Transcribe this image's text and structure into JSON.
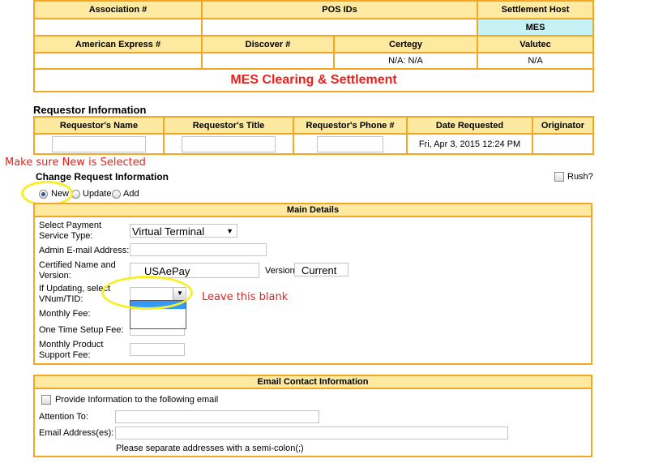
{
  "top_table": {
    "row1": [
      "Association #",
      "POS IDs",
      "Settlement Host"
    ],
    "row2": [
      "",
      "",
      "MES"
    ],
    "row3": [
      "American Express #",
      "Discover #",
      "Certegy",
      "Valutec"
    ],
    "row4": [
      "",
      "",
      "N/A: N/A",
      "N/A"
    ],
    "banner": "MES Clearing & Settlement"
  },
  "requestor": {
    "title": "Requestor Information",
    "headers": [
      "Requestor's Name",
      "Requestor's Title",
      "Requestor's Phone #",
      "Date Requested",
      "Originator"
    ],
    "date_requested": "Fri, Apr 3, 2015 12:24 PM"
  },
  "annotations": {
    "new_selected": "Make sure New is Selected",
    "leave_blank": "Leave this blank"
  },
  "change_request": {
    "title": "Change Request Information",
    "rush_label": "Rush?",
    "radios": [
      {
        "label": "New",
        "selected": true
      },
      {
        "label": "Update",
        "selected": false
      },
      {
        "label": "Add",
        "selected": false
      }
    ]
  },
  "main_details": {
    "header": "Main Details",
    "payment_service_label": "Select Payment Service Type:",
    "payment_service_value": "Virtual Terminal",
    "admin_email_label": "Admin E-mail Address:",
    "certified_label": "Certified Name and Version:",
    "certified_value": "USAePay",
    "version_label": "Version:",
    "version_value": "Current",
    "updating_label": "If Updating, select VNum/TID:",
    "monthly_fee_label": "Monthly Fee:",
    "setup_fee_label": "One Time Setup Fee:",
    "support_fee_label": "Monthly Product Support Fee:"
  },
  "email_contact": {
    "header": "Email Contact Information",
    "provide_label": "Provide Information to the following email",
    "attention_label": "Attention To:",
    "email_label": "Email Address(es):",
    "note": "Please separate addresses with a semi-colon(;)"
  },
  "colors": {
    "border": "#f5a623",
    "header_bg": "#fde9a0",
    "cyan": "#c5f2f5",
    "banner_red": "#e8211c",
    "highlight_yellow": "#f6ef2a"
  }
}
